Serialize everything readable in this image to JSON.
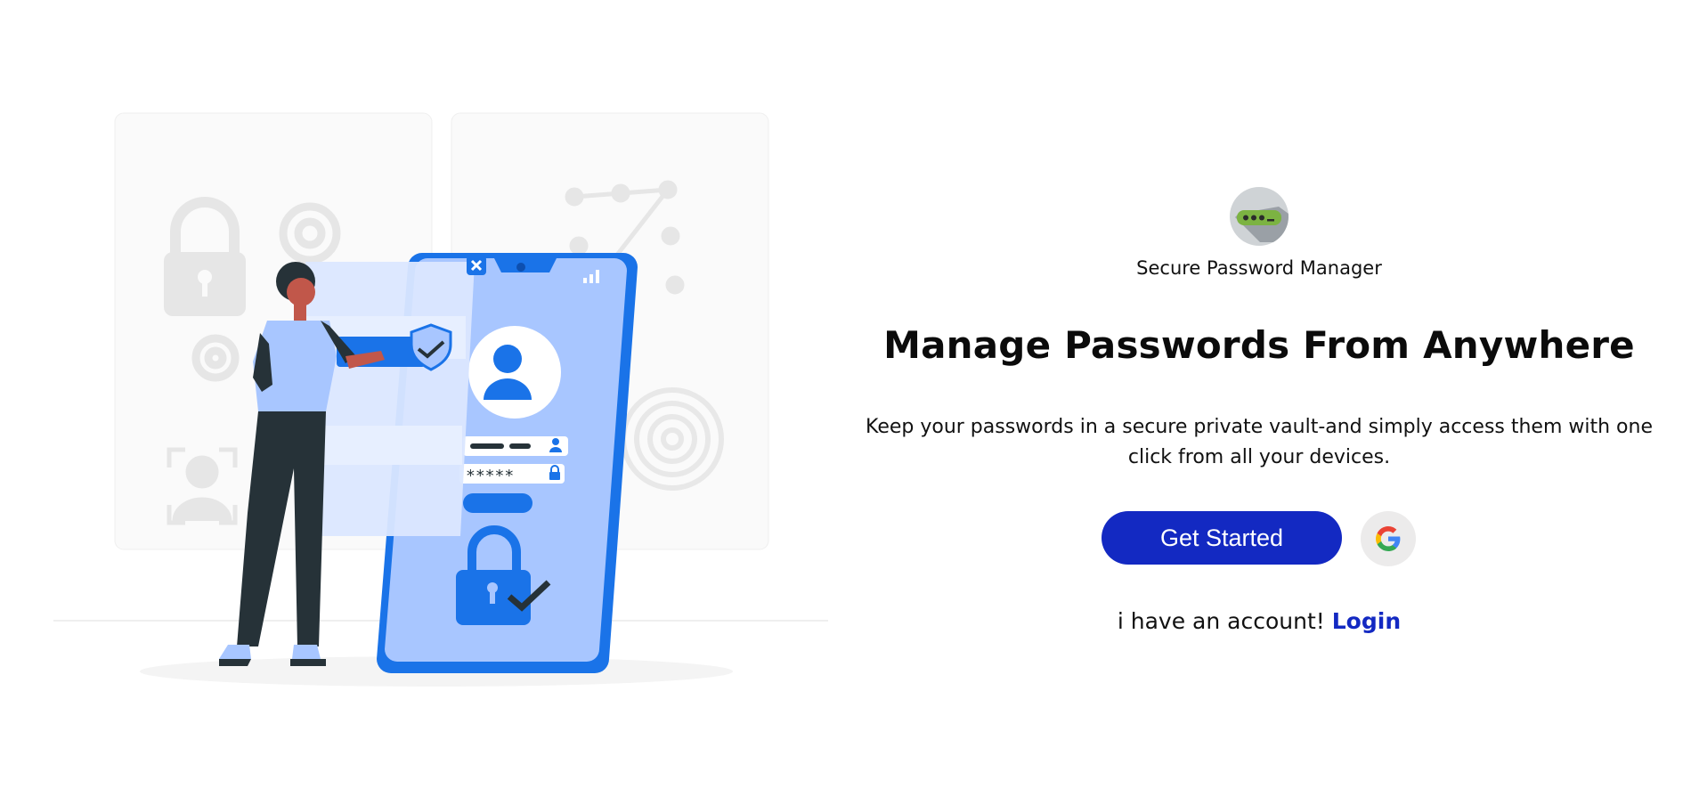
{
  "brand": {
    "name": "Secure Password Manager",
    "logo_icon": "password-field-icon"
  },
  "hero": {
    "headline": "Manage Passwords From Anywhere",
    "tagline_line1": "Keep your passwords in a secure private vault-and simply access them with one",
    "tagline_line2": "click from all your devices."
  },
  "actions": {
    "get_started_label": "Get Started",
    "google_icon": "google-icon"
  },
  "account": {
    "prompt": "i have an account!",
    "login_label": "Login"
  },
  "illustration": {
    "password_mask": "*****",
    "icons": [
      "padlock-icon",
      "gear-icon",
      "fingerprint-icon",
      "user-avatar-icon",
      "shield-check-icon",
      "close-icon"
    ]
  },
  "colors": {
    "primary": "#1329c2",
    "illustration_blue": "#1a73e8",
    "illustration_light": "#a8c6ff"
  }
}
